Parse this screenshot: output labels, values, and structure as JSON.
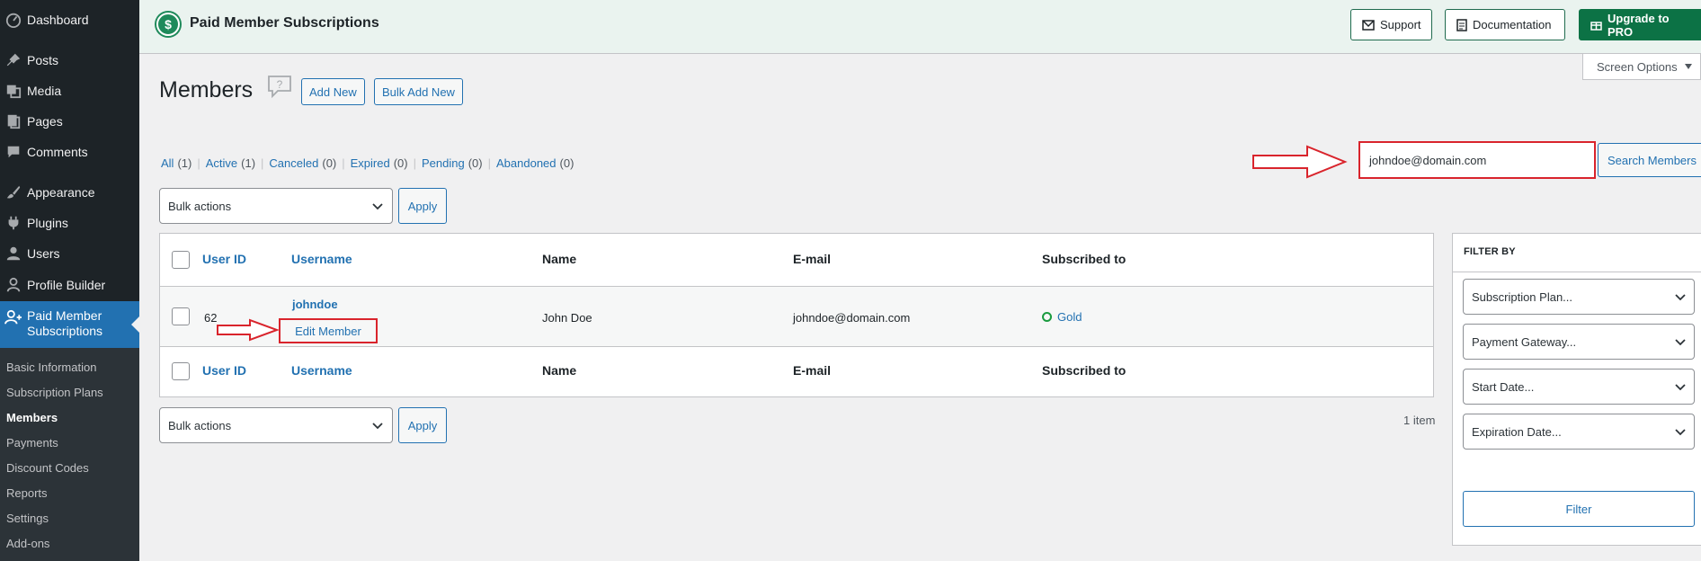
{
  "sidebar": {
    "items": [
      {
        "label": "Dashboard",
        "icon": "dashboard-icon"
      },
      {
        "label": "Posts",
        "icon": "pin-icon"
      },
      {
        "label": "Media",
        "icon": "media-icon"
      },
      {
        "label": "Pages",
        "icon": "pages-icon"
      },
      {
        "label": "Comments",
        "icon": "comments-icon"
      },
      {
        "label": "Appearance",
        "icon": "brush-icon"
      },
      {
        "label": "Plugins",
        "icon": "plug-icon"
      },
      {
        "label": "Users",
        "icon": "user-icon"
      },
      {
        "label": "Profile Builder",
        "icon": "user-icon"
      },
      {
        "label": "Paid Member Subscriptions",
        "icon": "members-icon"
      }
    ],
    "submenu": [
      "Basic Information",
      "Subscription Plans",
      "Members",
      "Payments",
      "Discount Codes",
      "Reports",
      "Settings",
      "Add-ons"
    ],
    "current_submenu": "Members"
  },
  "header": {
    "title": "Paid Member Subscriptions",
    "support": "Support",
    "documentation": "Documentation",
    "upgrade": "Upgrade to PRO"
  },
  "screen_options": "Screen Options",
  "page": {
    "title": "Members",
    "add_new": "Add New",
    "bulk_add_new": "Bulk Add New"
  },
  "views": [
    {
      "label": "All",
      "count": "(1)"
    },
    {
      "label": "Active",
      "count": "(1)"
    },
    {
      "label": "Canceled",
      "count": "(0)"
    },
    {
      "label": "Expired",
      "count": "(0)"
    },
    {
      "label": "Pending",
      "count": "(0)"
    },
    {
      "label": "Abandoned",
      "count": "(0)"
    }
  ],
  "search": {
    "value": "johndoe@domain.com",
    "button": "Search Members"
  },
  "bulk": {
    "label": "Bulk actions",
    "apply": "Apply"
  },
  "table": {
    "columns": [
      "User ID",
      "Username",
      "Name",
      "E-mail",
      "Subscribed to"
    ],
    "rows": [
      {
        "user_id": "62",
        "username": "johndoe",
        "edit": "Edit Member",
        "name": "John Doe",
        "email": "johndoe@domain.com",
        "subscription": "Gold"
      }
    ]
  },
  "item_count": "1 item",
  "filter": {
    "title": "FILTER BY",
    "subscription_plan": "Subscription Plan...",
    "payment_gateway": "Payment Gateway...",
    "start_date": "Start Date...",
    "expiration_date": "Expiration Date...",
    "button": "Filter"
  },
  "colors": {
    "accent": "#2271b1",
    "brand": "#0c7245",
    "annotation": "#d9242c",
    "active_status": "#1a9b3f"
  }
}
